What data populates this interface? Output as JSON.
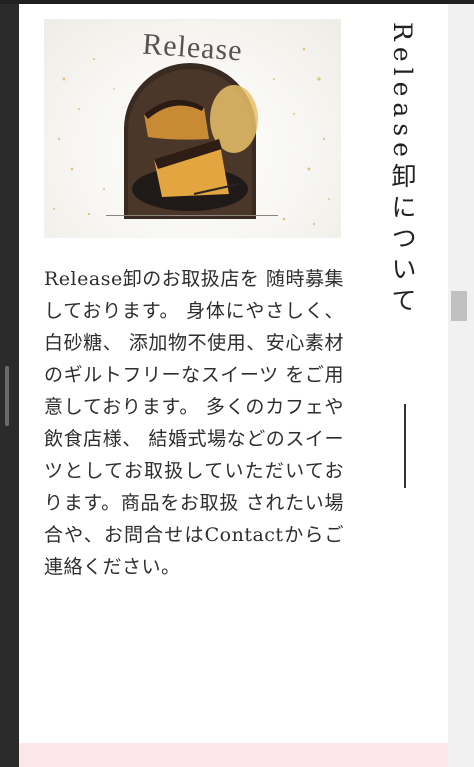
{
  "hero": {
    "title": "Release"
  },
  "section": {
    "heading": "Release卸について",
    "body": "Release卸のお取扱店を 随時募集しております。 身体にやさしく、白砂糖、 添加物不使用、安心素材 のギルトフリーなスイーツ をご用意しております。 多くのカフェや飲食店様、 結婚式場などのスイーツとしてお取扱していただいております。商品をお取扱 されたい場合や、お問合せはContactからご連絡ください。"
  },
  "colors": {
    "accent_band": "#fde6ea"
  },
  "icons": {
    "cake_photo": "cheesecake-image"
  }
}
